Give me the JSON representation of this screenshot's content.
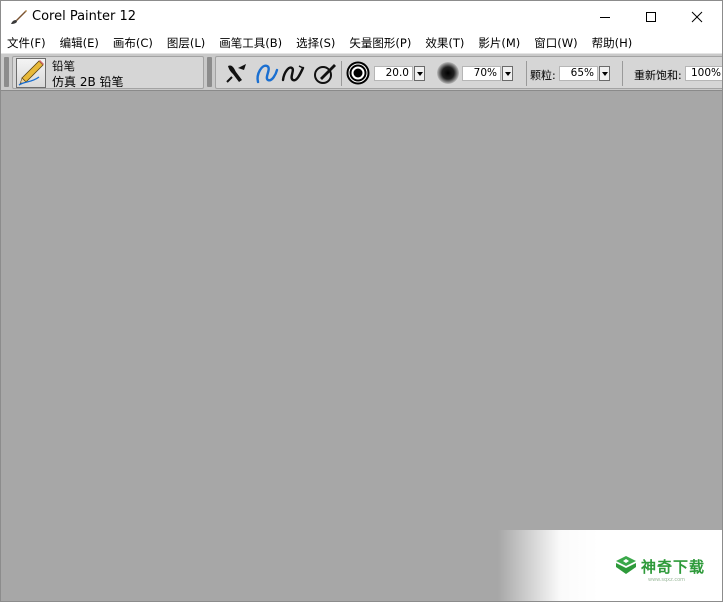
{
  "window": {
    "title": "Corel Painter 12"
  },
  "menubar": {
    "items": [
      "文件(F)",
      "编辑(E)",
      "画布(C)",
      "图层(L)",
      "画笔工具(B)",
      "选择(S)",
      "矢量图形(P)",
      "效果(T)",
      "影片(M)",
      "窗口(W)",
      "帮助(H)"
    ]
  },
  "brush_selector": {
    "category": "铅笔",
    "variant": "仿真 2B 铅笔"
  },
  "property_bar": {
    "size_value": "20.0",
    "opacity_value": "70%",
    "grain_label": "颗粒:",
    "grain_value": "65%",
    "resaturation_label": "重新饱和:",
    "resaturation_value": "100%"
  },
  "watermark": {
    "text": "神奇下载",
    "url": "www.sqxz.com"
  },
  "colors": {
    "workspace": "#a7a7a7",
    "property_bar": "#c9c9c9",
    "accent_blue": "#1a6fd1"
  },
  "icons": [
    "painter-brush-icon",
    "minimize-icon",
    "maximize-icon",
    "close-icon",
    "pencil-brush-icon",
    "dab-type-icon",
    "stroke-freehand-icon",
    "stroke-straight-icon",
    "brush-ghost-icon",
    "size-icon",
    "opacity-icon"
  ]
}
